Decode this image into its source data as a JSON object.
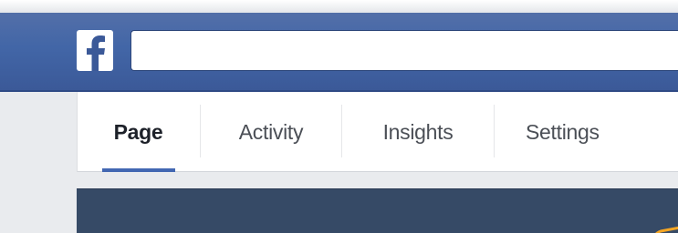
{
  "header": {
    "logo_letter": "f",
    "search": {
      "value": "",
      "placeholder": ""
    }
  },
  "tabs": [
    {
      "label": "Page",
      "active": true
    },
    {
      "label": "Activity",
      "active": false
    },
    {
      "label": "Insights",
      "active": false
    },
    {
      "label": "Settings",
      "active": false
    }
  ],
  "colors": {
    "brand_blue": "#3b5998",
    "active_tab_indicator": "#4267b2",
    "cover_background": "#364a66",
    "cover_accent": "#f5a623",
    "page_background": "#e9ebee"
  },
  "icons": [
    "facebook-logo-icon"
  ]
}
